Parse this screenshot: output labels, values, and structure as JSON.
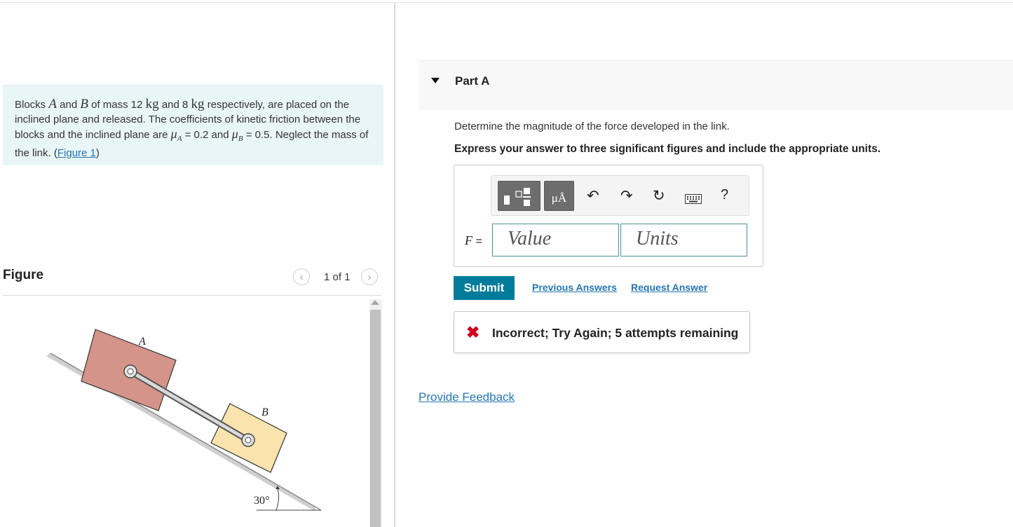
{
  "problem": {
    "text_1": "Blocks ",
    "var_a": "A",
    "text_2": " and ",
    "var_b": "B",
    "text_3": " of mass 12 ",
    "unit_kg1": "kg",
    "text_4": " and 8 ",
    "unit_kg2": "kg",
    "text_5": " respectively, are placed on the inclined plane and released. The coefficients of kinetic friction between the blocks and the inclined plane are ",
    "mu_a_sym": "μ",
    "mu_a_sub": "A",
    "mu_a_val": " = 0.2 and ",
    "mu_b_sym": "μ",
    "mu_b_sub": "B",
    "mu_b_val": " = 0.5.",
    "text_6": " Neglect the mass of the link. (",
    "figure_link": "Figure 1",
    "text_7": ")"
  },
  "figure_panel": {
    "label": "Figure",
    "pager": "1 of 1",
    "prev_icon": "chevron-left-icon",
    "next_icon": "chevron-right-icon",
    "label_a": "A",
    "label_b": "B",
    "angle": "30°"
  },
  "part": {
    "title": "Part A",
    "question": "Determine the magnitude of the force developed in the link.",
    "instruction": "Express your answer to three significant figures and include the appropriate units."
  },
  "toolbar": {
    "units_label": "μÅ",
    "icons": [
      "templates-icon",
      "units-icon",
      "undo-icon",
      "redo-icon",
      "reset-icon",
      "keyboard-icon",
      "help-icon"
    ],
    "help": "?"
  },
  "answer": {
    "variable": "F",
    "equals": " =",
    "value_placeholder": "Value",
    "units_placeholder": "Units"
  },
  "actions": {
    "submit": "Submit",
    "previous_answers": "Previous Answers",
    "request_answer": "Request Answer"
  },
  "feedback": {
    "text": "Incorrect; Try Again; 5 attempts remaining",
    "icon": "x-icon",
    "color": "#d0021b"
  },
  "footer": {
    "provide_feedback": "Provide Feedback"
  },
  "colors": {
    "accent": "#007c9a",
    "link": "#2576b4",
    "problem_bg": "#e9f6f7",
    "block_a": "#d4948a",
    "block_b": "#fbe3ad"
  }
}
